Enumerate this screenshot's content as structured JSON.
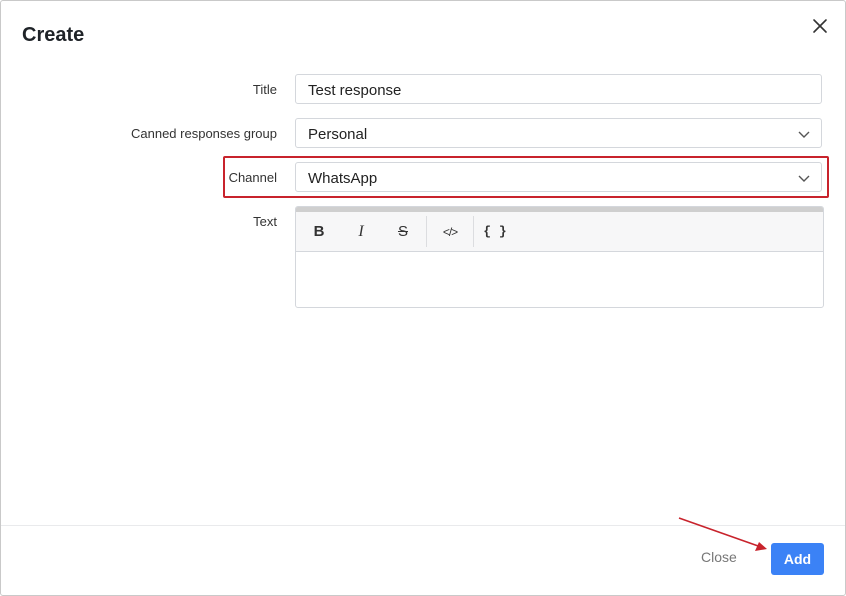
{
  "dialog": {
    "title": "Create"
  },
  "form": {
    "title_label": "Title",
    "title_value": "Test response",
    "group_label": "Canned responses group",
    "group_value": "Personal",
    "channel_label": "Channel",
    "channel_value": "WhatsApp",
    "text_label": "Text"
  },
  "editor": {
    "bold": "B",
    "italic": "I",
    "strike": "S",
    "code": "</>",
    "variables": "{ }"
  },
  "footer": {
    "close_label": "Close",
    "add_label": "Add"
  },
  "colors": {
    "accent": "#3b82f6",
    "highlight": "#c8232c"
  }
}
